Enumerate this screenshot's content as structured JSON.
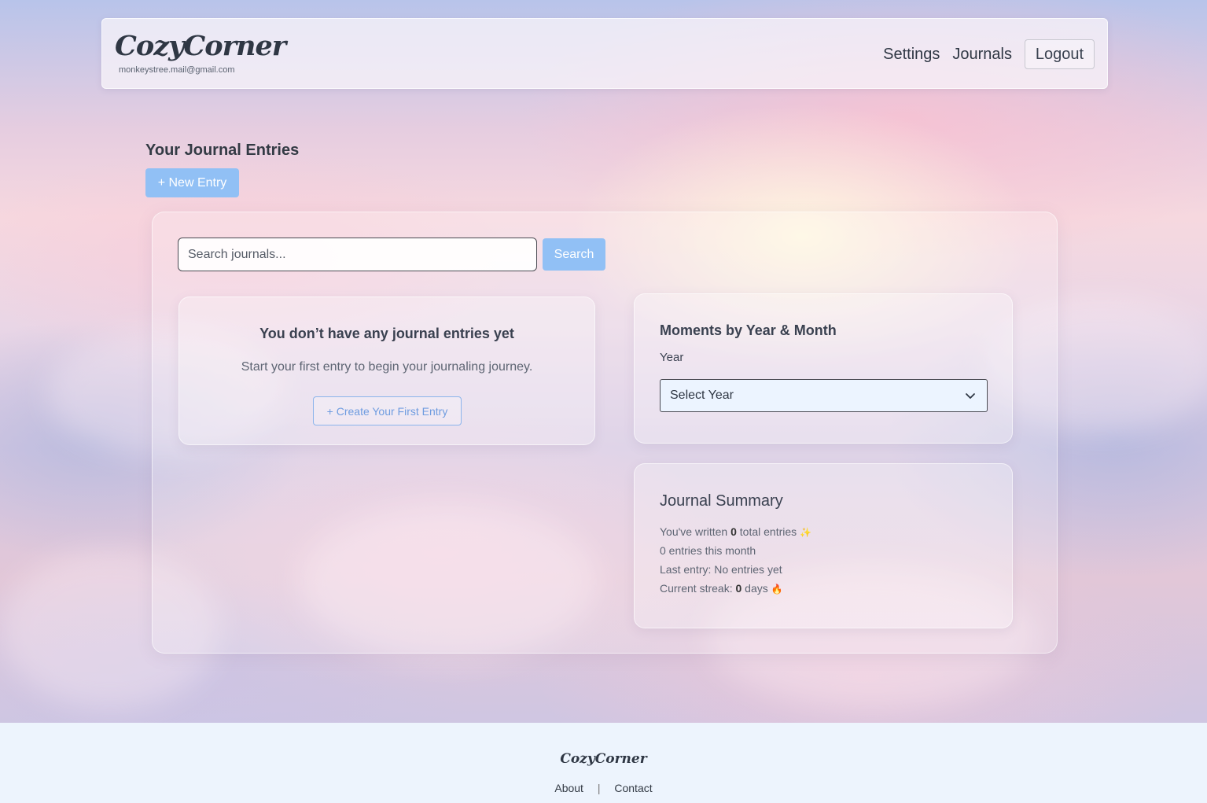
{
  "header": {
    "brand": "CozyCorner",
    "user_email": "monkeystree.mail@gmail.com",
    "nav": {
      "settings": "Settings",
      "journals": "Journals",
      "logout": "Logout"
    }
  },
  "page": {
    "title": "Your Journal Entries",
    "new_entry_label": "+ New Entry"
  },
  "search": {
    "placeholder": "Search journals...",
    "button_label": "Search"
  },
  "empty_state": {
    "title": "You don’t have any journal entries yet",
    "subtitle": "Start your first entry to begin your journaling journey.",
    "button_label": "+ Create Your First Entry"
  },
  "moments": {
    "title": "Moments by Year & Month",
    "year_label": "Year",
    "year_selected": "Select Year"
  },
  "summary": {
    "title": "Journal Summary",
    "total_prefix": "You've written ",
    "total_count": "0",
    "total_suffix": " total entries",
    "month_text": "0 entries this month",
    "last_entry": "Last entry: No entries yet",
    "streak_prefix": "Current streak: ",
    "streak_count": "0",
    "streak_suffix": " days",
    "sparkle_icon": "✨",
    "fire_icon": "🔥"
  },
  "footer": {
    "brand": "CozyCorner",
    "about": "About",
    "separator": "|",
    "contact": "Contact"
  }
}
